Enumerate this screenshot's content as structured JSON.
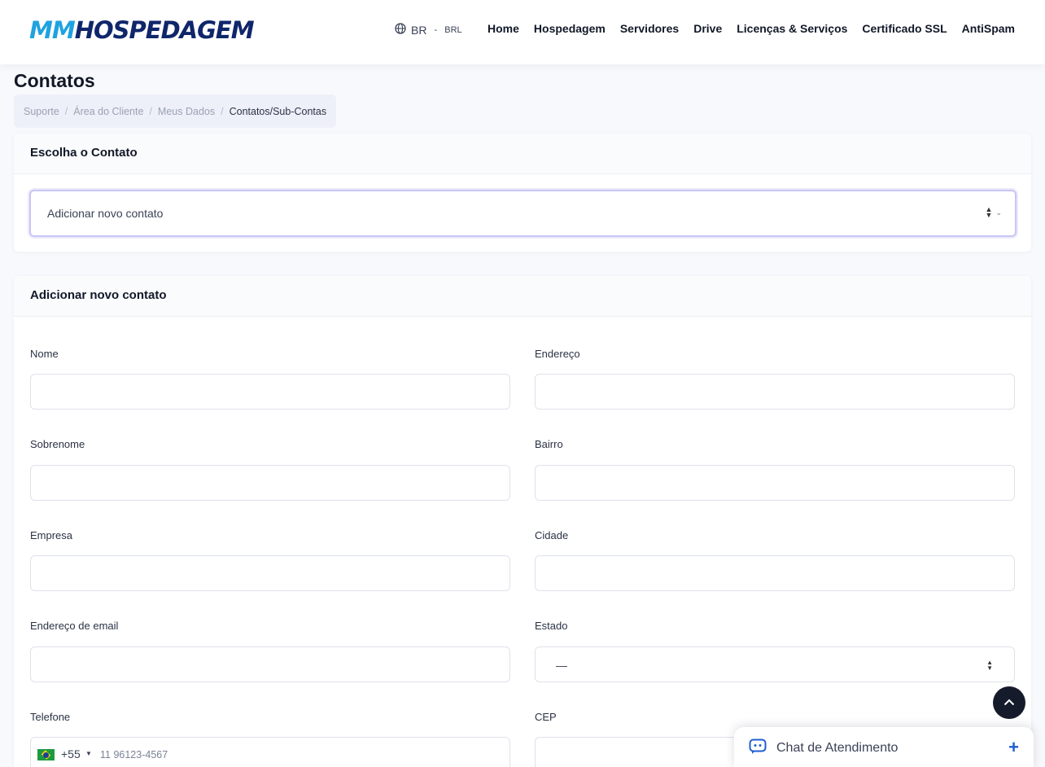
{
  "header": {
    "logo_part1": "MM",
    "logo_part2": "HOSPEDAGEM",
    "lang_code": "BR",
    "lang_sep": " - ",
    "currency": "BRL",
    "nav": [
      "Home",
      "Hospedagem",
      "Servidores",
      "Drive",
      "Licenças & Serviços",
      "Certificado SSL",
      "AntiSpam"
    ]
  },
  "page": {
    "title": "Contatos",
    "breadcrumb": [
      "Suporte",
      "Área do Cliente",
      "Meus Dados",
      "Contatos/Sub-Contas"
    ]
  },
  "choose_card": {
    "title": "Escolha o Contato",
    "selected": "Adicionar novo contato"
  },
  "form_card": {
    "title": "Adicionar novo contato",
    "labels": {
      "nome": "Nome",
      "sobrenome": "Sobrenome",
      "empresa": "Empresa",
      "email": "Endereço de email",
      "telefone": "Telefone",
      "endereco": "Endereço",
      "bairro": "Bairro",
      "cidade": "Cidade",
      "estado": "Estado",
      "cep": "CEP"
    },
    "estado_value": "—",
    "phone_code": "+55",
    "phone_placeholder": "11 96123-4567"
  },
  "chat": {
    "title": "Chat de Atendimento"
  },
  "colors": {
    "logo_light": "#1fa2e0",
    "logo_dark": "#10266b",
    "chat_accent": "#1f5ed1",
    "focus_border": "#c8c6f4"
  }
}
